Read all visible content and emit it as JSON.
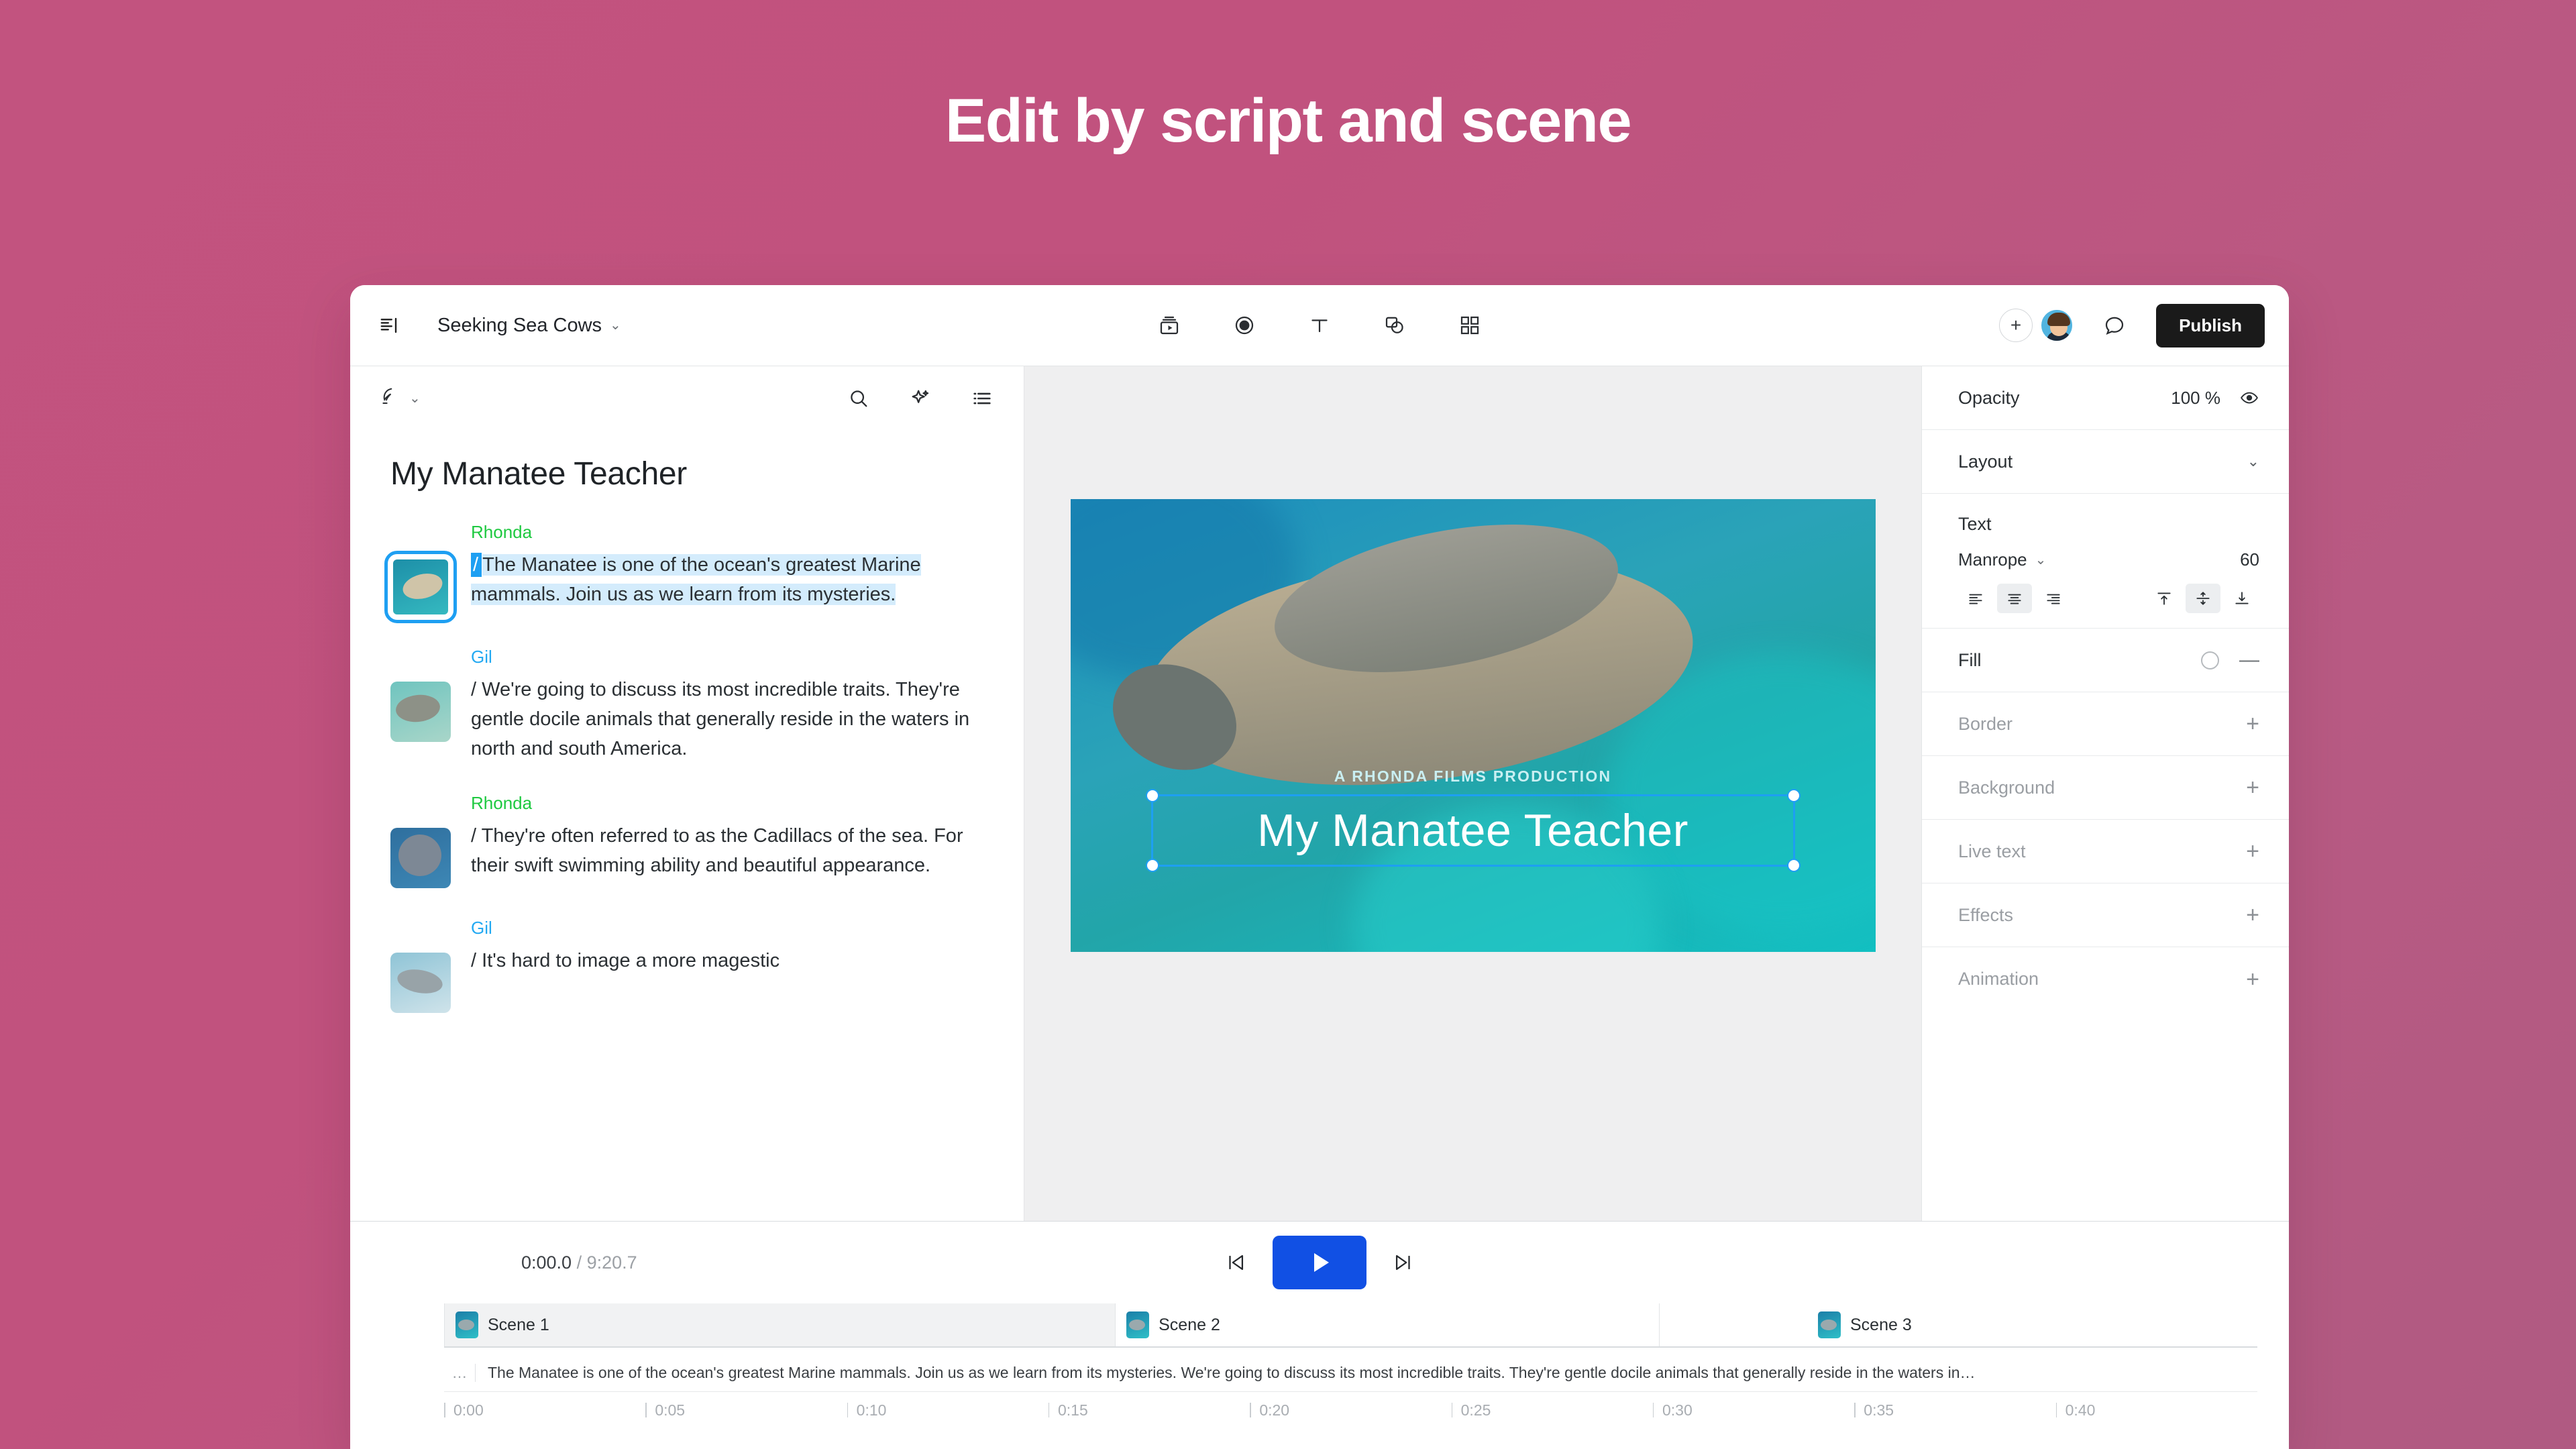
{
  "hero": {
    "title": "Edit by script and scene"
  },
  "theme": {
    "bg_start": "#c2537f",
    "bg_end": "#b05a82",
    "accent_blue": "#1e9ff2",
    "play_blue": "#1150e4",
    "speaker_green": "#1ec940",
    "speaker_blue": "#23a9f2",
    "highlight": "#d4ecfc"
  },
  "topbar": {
    "menu_icon": "sidebar-toggle-icon",
    "doc_title": "Seeking Sea Cows",
    "doc_chevron": "⌄",
    "tools": [
      {
        "name": "media-library-icon"
      },
      {
        "name": "record-icon"
      },
      {
        "name": "text-tool-icon"
      },
      {
        "name": "shapes-icon"
      },
      {
        "name": "templates-grid-icon"
      }
    ],
    "add_collaborator": "+",
    "avatar_name": "avatar",
    "comment_icon": "comment-icon",
    "publish_label": "Publish"
  },
  "script_panel": {
    "mode_icon": "feather-pen-icon",
    "mode_chevron": "⌄",
    "actions": [
      {
        "name": "search-icon"
      },
      {
        "name": "ai-sparkle-icon"
      },
      {
        "name": "list-view-icon"
      }
    ],
    "title": "My Manatee Teacher",
    "blocks": [
      {
        "speaker": "Rhonda",
        "speaker_color": "green",
        "selected": true,
        "cursor": "/",
        "text": "The Manatee is one of the ocean's greatest Marine mammals. Join us as we learn from its mysteries."
      },
      {
        "speaker": "Gil",
        "speaker_color": "blue",
        "selected": false,
        "text": "/ We're going to discuss its most incredible traits. They're gentle docile animals that generally reside in the waters in north and south America."
      },
      {
        "speaker": "Rhonda",
        "speaker_color": "green",
        "selected": false,
        "text": "/ They're often referred to as the Cadillacs of the sea. For their swift swimming ability and beautiful appearance."
      },
      {
        "speaker": "Gil",
        "speaker_color": "blue",
        "selected": false,
        "text": "/ It's hard to image a more magestic"
      }
    ]
  },
  "canvas": {
    "subtitle": "A RHONDA FILMS PRODUCTION",
    "title": "My Manatee Teacher"
  },
  "properties": {
    "opacity_label": "Opacity",
    "opacity_value": "100 %",
    "opacity_eye_icon": "eye-icon",
    "layout_label": "Layout",
    "layout_chevron": "⌄",
    "text_label": "Text",
    "font_family": "Manrope",
    "font_chevron": "⌄",
    "font_size": "60",
    "align_h": [
      {
        "name": "align-left-icon",
        "active": false
      },
      {
        "name": "align-center-icon",
        "active": true
      },
      {
        "name": "align-right-icon",
        "active": false
      }
    ],
    "align_v": [
      {
        "name": "align-top-icon",
        "active": false
      },
      {
        "name": "align-middle-icon",
        "active": true
      },
      {
        "name": "align-bottom-icon",
        "active": false
      }
    ],
    "fill_label": "Fill",
    "fill_minus": "—",
    "rows": [
      {
        "label": "Border",
        "action": "+"
      },
      {
        "label": "Background",
        "action": "+"
      },
      {
        "label": "Live text",
        "action": "+"
      },
      {
        "label": "Effects",
        "action": "+"
      },
      {
        "label": "Animation",
        "action": "+"
      }
    ]
  },
  "timeline": {
    "current_time": "0:00.0",
    "separator": "/",
    "total_time": "9:20.7",
    "prev_icon": "skip-to-start-icon",
    "play_icon": "play-icon",
    "next_icon": "skip-to-end-icon",
    "scenes": [
      {
        "label": "Scene 1",
        "active": true,
        "width": 37
      },
      {
        "label": "Scene 2",
        "active": false,
        "width": 30
      },
      {
        "label": "Scene 3",
        "active": false,
        "width": 33
      }
    ],
    "caption_ellipsis": "…",
    "caption_text": "The Manatee is one of the ocean's greatest Marine mammals. Join us as we learn from its mysteries. We're going to discuss its most incredible traits. They're gentle docile animals that generally reside in the waters in…",
    "ruler_ticks": [
      "0:00",
      "0:05",
      "0:10",
      "0:15",
      "0:20",
      "0:25",
      "0:30",
      "0:35",
      "0:40"
    ]
  }
}
